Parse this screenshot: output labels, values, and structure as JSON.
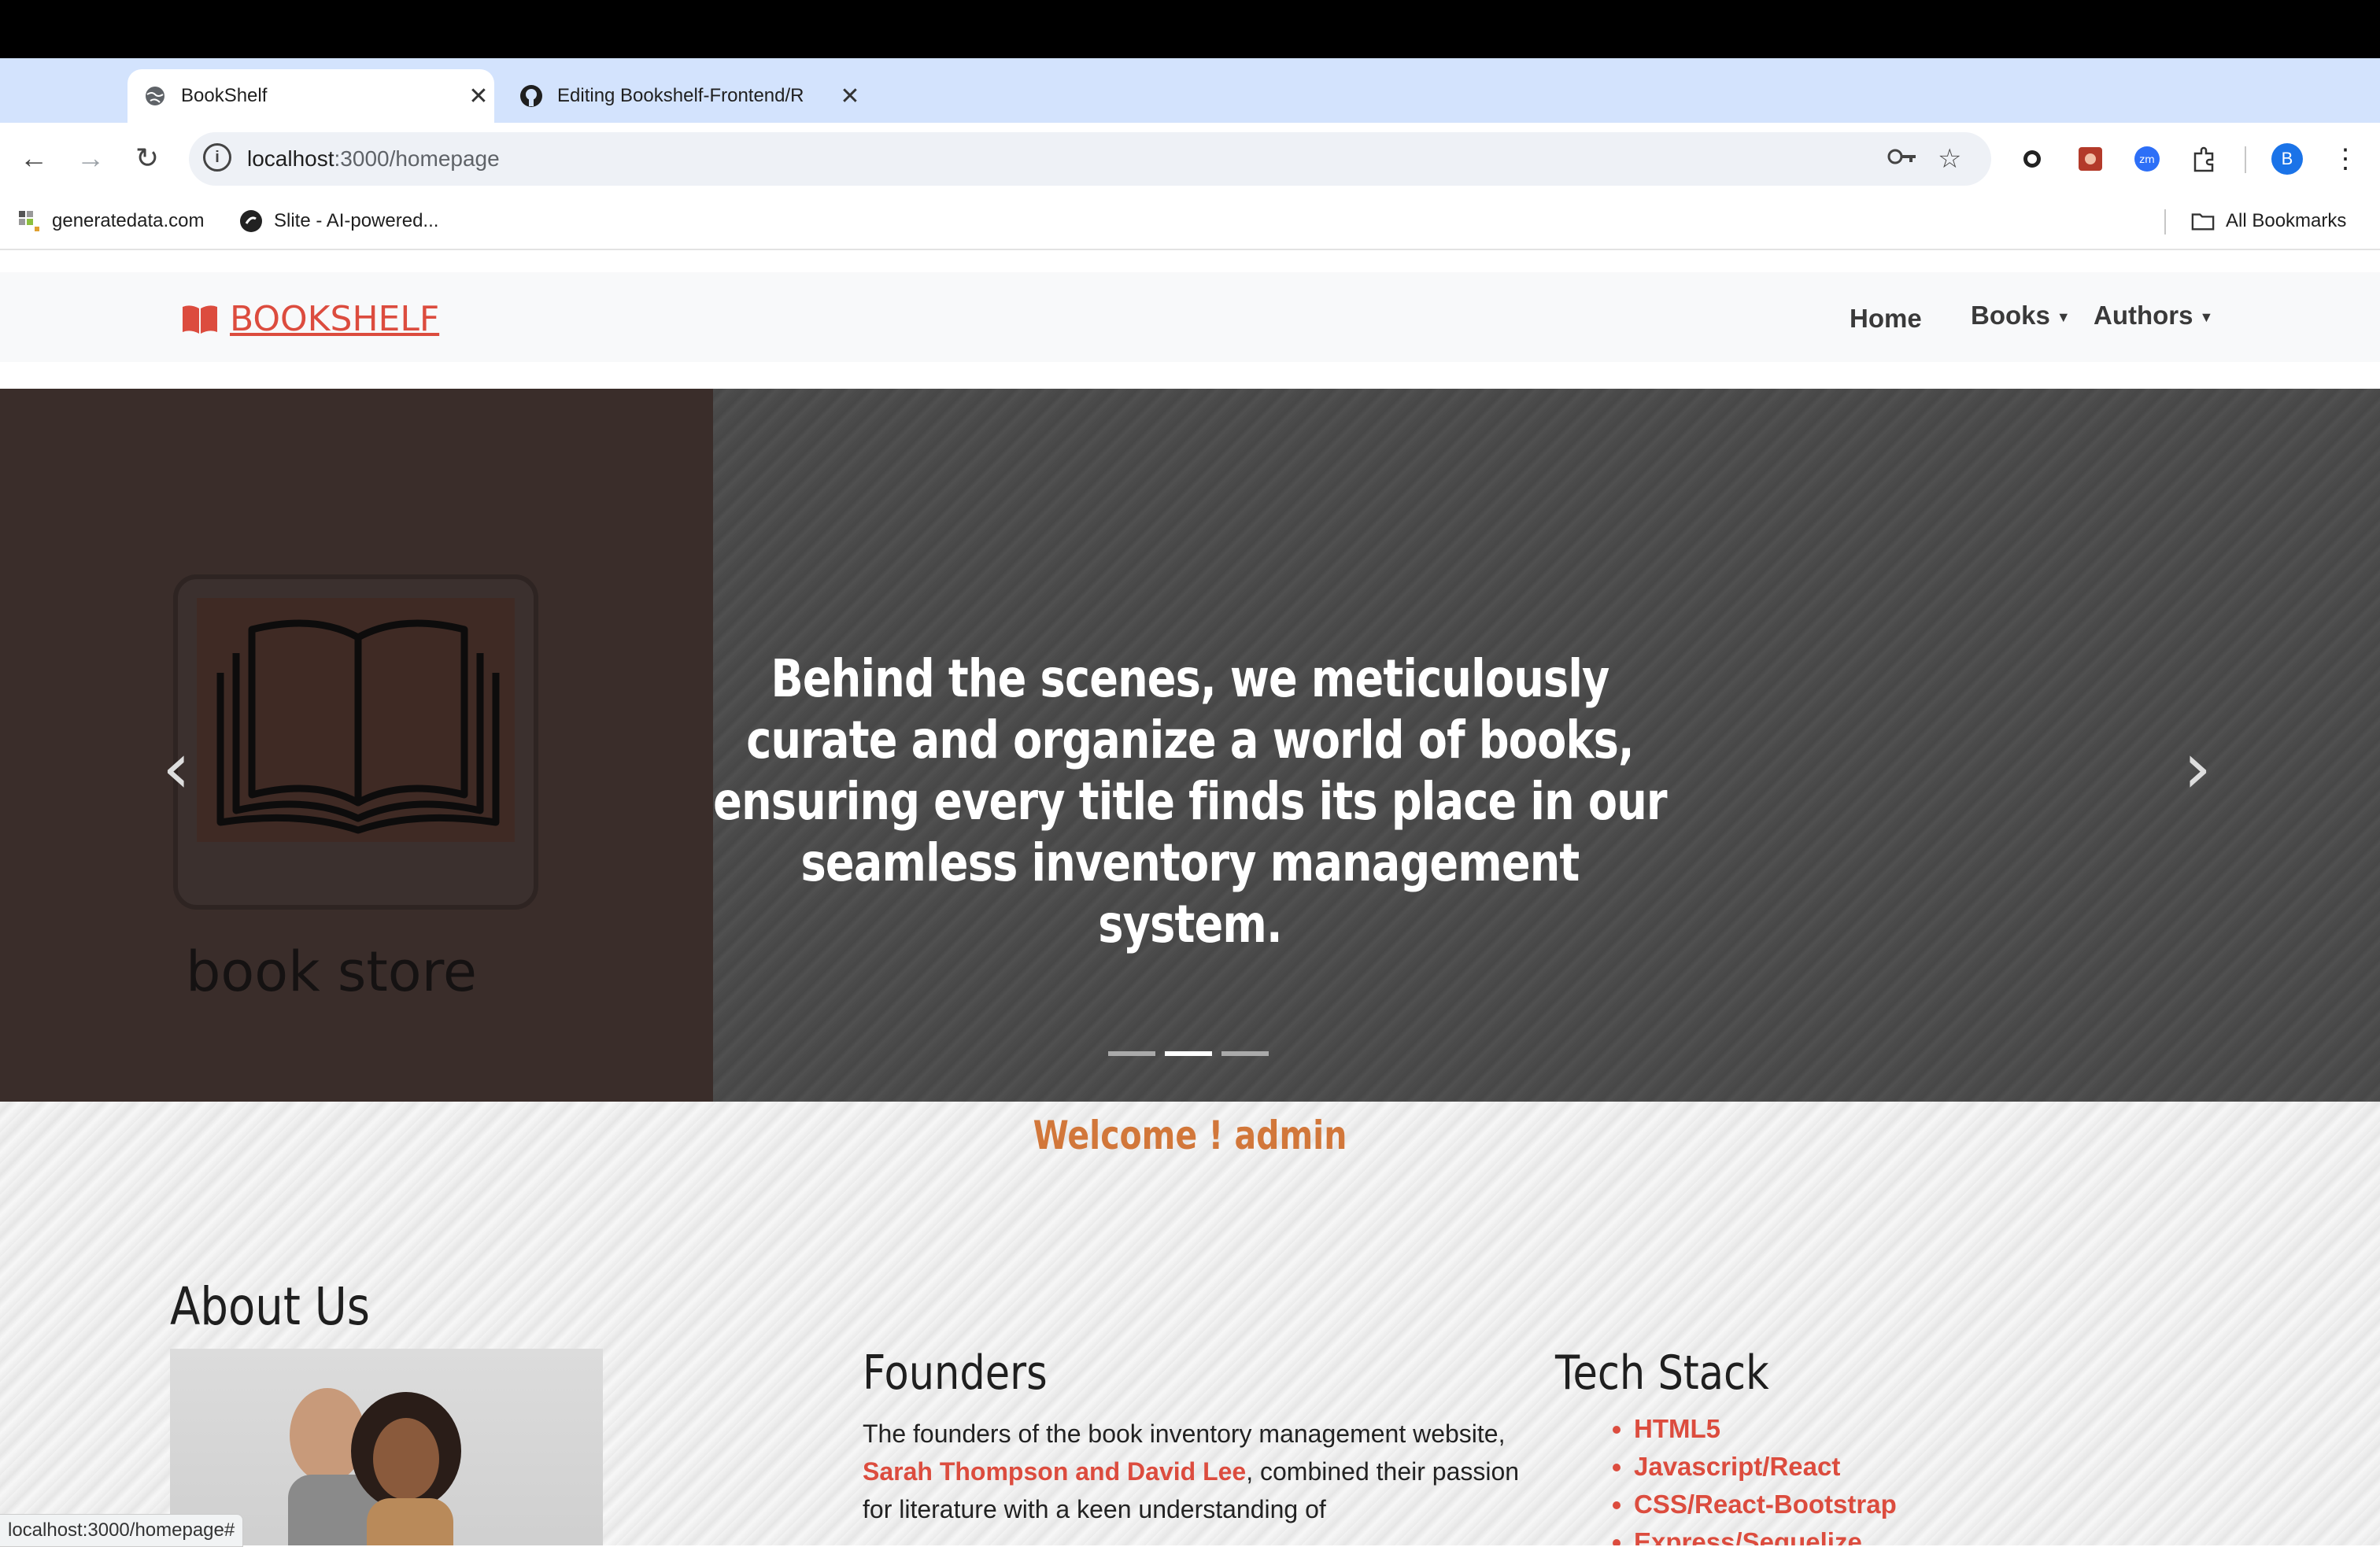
{
  "browser": {
    "tabs": [
      {
        "title": "BookShelf",
        "active": true
      },
      {
        "title": "Editing Bookshelf-Frontend/R",
        "active": false
      }
    ],
    "url_host": "localhost",
    "url_path": ":3000/homepage",
    "bookmarks": [
      {
        "label": "generatedata.com"
      },
      {
        "label": "Slite - AI-powered..."
      }
    ],
    "all_bookmarks_label": "All Bookmarks",
    "profile_initial": "B",
    "status_url": "localhost:3000/homepage#"
  },
  "site": {
    "brand": "BOOKSHELF",
    "nav": {
      "home": "Home",
      "books": "Books",
      "authors": "Authors"
    },
    "hero": {
      "caption": "Behind the scenes, we meticulously curate and organize a world of books, ensuring every title finds its place in our seamless inventory management system.",
      "image_text": "book store",
      "active_slide": 1,
      "slide_count": 3
    },
    "welcome": "Welcome ! admin",
    "about_heading": "About Us",
    "founders": {
      "heading": "Founders",
      "text_before": "The founders of the book inventory management website, ",
      "names": "Sarah Thompson and David Lee",
      "text_after": ", combined their passion for literature with a keen understanding of"
    },
    "tech_stack": {
      "heading": "Tech Stack",
      "items": [
        "HTML5",
        "Javascript/React",
        "CSS/React-Bootstrap",
        "Express/Sequelize"
      ]
    }
  },
  "colors": {
    "brand": "#dc4c3e",
    "welcome": "#d2773a",
    "tab_strip": "#d3e3fd"
  }
}
